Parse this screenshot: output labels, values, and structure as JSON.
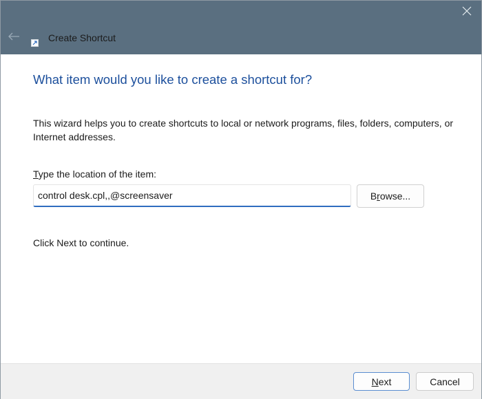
{
  "window": {
    "title": "Create Shortcut",
    "icons": {
      "close": "close-icon",
      "back": "back-arrow-icon",
      "app": "shortcut-arrow-icon"
    }
  },
  "content": {
    "heading": "What item would you like to create a shortcut for?",
    "description": "This wizard helps you to create shortcuts to local or network programs, files, folders, computers, or Internet addresses.",
    "location_label_mnemonic": "T",
    "location_label_rest": "ype the location of the item:",
    "location_value": "control desk.cpl,,@screensaver",
    "browse_mnemonic": "r",
    "browse_before": "B",
    "browse_after": "owse...",
    "hint": "Click Next to continue."
  },
  "footer": {
    "next_mnemonic": "N",
    "next_rest": "ext",
    "cancel_label": "Cancel"
  },
  "colors": {
    "titlebar": "#5a6f80",
    "heading": "#1c4f9c",
    "input_focus": "#2f6dbf",
    "footer": "#f0f0f0"
  }
}
